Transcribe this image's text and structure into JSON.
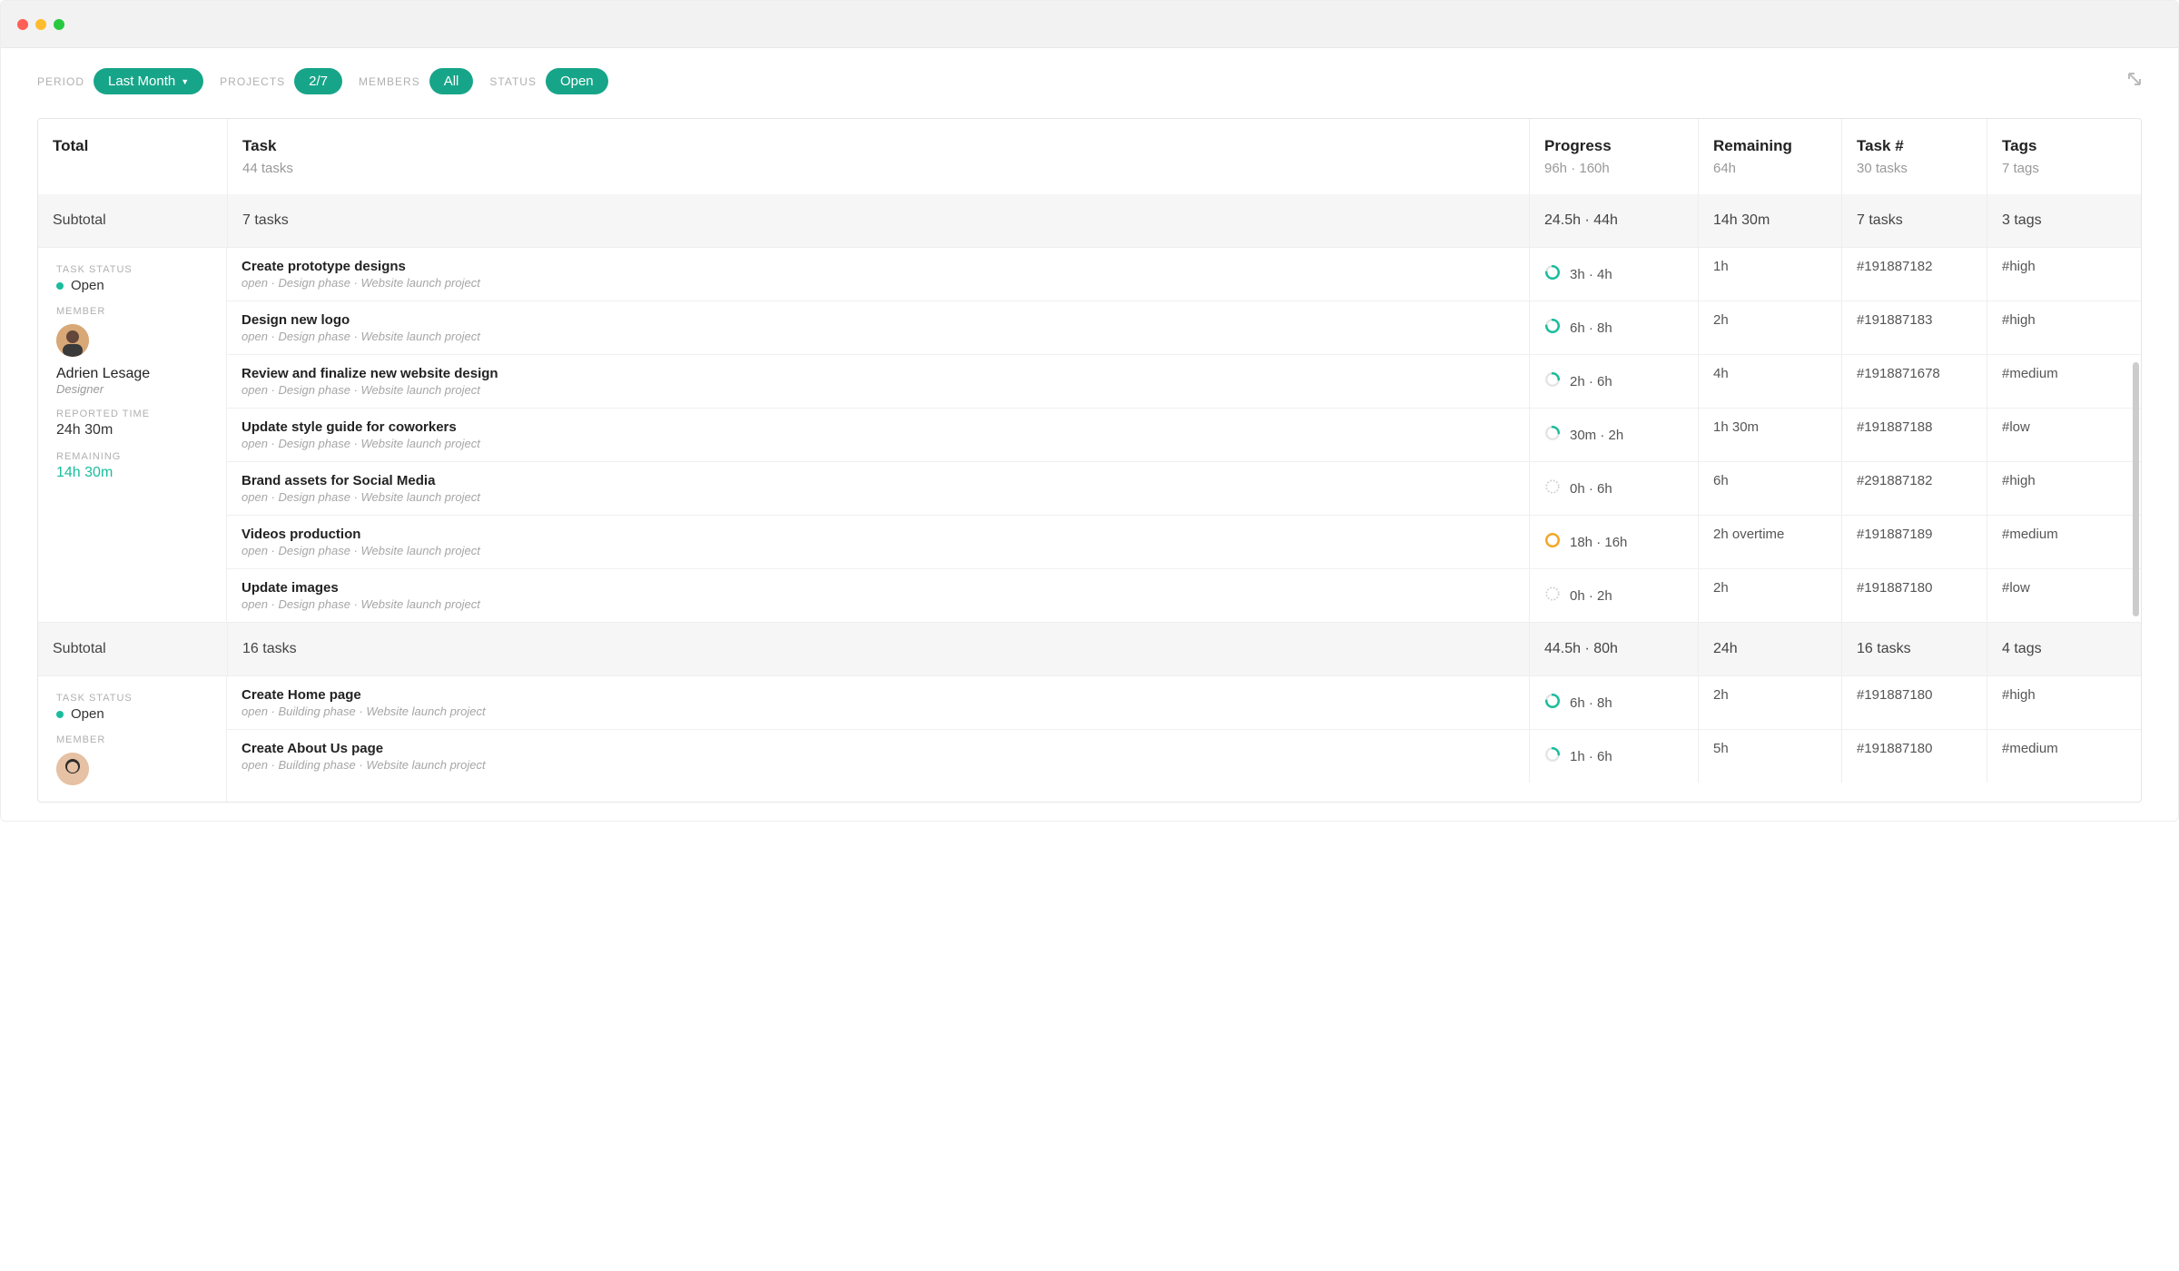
{
  "filters": {
    "period": {
      "label": "PERIOD",
      "value": "Last Month"
    },
    "projects": {
      "label": "PROJECTS",
      "value": "2/7"
    },
    "members": {
      "label": "MEMBERS",
      "value": "All"
    },
    "status": {
      "label": "STATUS",
      "value": "Open"
    }
  },
  "header": {
    "total_label": "Total",
    "task": {
      "label": "Task",
      "sub": "44 tasks"
    },
    "progress": {
      "label": "Progress",
      "sub": "96h · 160h"
    },
    "remaining": {
      "label": "Remaining",
      "sub": "64h"
    },
    "taskno": {
      "label": "Task #",
      "sub": "30 tasks"
    },
    "tags": {
      "label": "Tags",
      "sub": "7 tags"
    }
  },
  "groups": [
    {
      "subtotal": {
        "label": "Subtotal",
        "tasks": "7 tasks",
        "progress": "24.5h · 44h",
        "remaining": "14h 30m",
        "taskno": "7 tasks",
        "tags": "3 tags"
      },
      "side": {
        "status_label": "TASK STATUS",
        "status_value": "Open",
        "member_label": "MEMBER",
        "member_name": "Adrien Lesage",
        "member_role": "Designer",
        "reported_label": "REPORTED TIME",
        "reported_value": "24h 30m",
        "remaining_label": "REMAINING",
        "remaining_value": "14h 30m"
      },
      "tasks": [
        {
          "title": "Create prototype designs",
          "meta": "open · Design phase · Website launch project",
          "progress": "3h · 4h",
          "ring": "green-high",
          "remaining": "1h",
          "taskno": "#191887182",
          "tag": "#high"
        },
        {
          "title": "Design new logo",
          "meta": "open · Design phase · Website launch project",
          "progress": "6h · 8h",
          "ring": "green-high",
          "remaining": "2h",
          "taskno": "#191887183",
          "tag": "#high"
        },
        {
          "title": "Review and finalize new website design",
          "meta": "open · Design phase · Website launch project",
          "progress": "2h · 6h",
          "ring": "green-low",
          "remaining": "4h",
          "taskno": "#1918871678",
          "tag": "#medium"
        },
        {
          "title": "Update style guide for coworkers",
          "meta": "open · Design phase · Website launch project",
          "progress": "30m · 2h",
          "ring": "green-low",
          "remaining": "1h 30m",
          "taskno": "#191887188",
          "tag": "#low"
        },
        {
          "title": "Brand assets for Social Media",
          "meta": "open · Design phase · Website launch project",
          "progress": "0h · 6h",
          "ring": "empty",
          "remaining": "6h",
          "taskno": "#291887182",
          "tag": "#high"
        },
        {
          "title": "Videos production",
          "meta": "open · Design phase · Website launch project",
          "progress": "18h · 16h",
          "ring": "over",
          "remaining": "2h overtime",
          "overtime": true,
          "taskno": "#191887189",
          "tag": "#medium"
        },
        {
          "title": "Update images",
          "meta": "open · Design phase · Website launch project",
          "progress": "0h · 2h",
          "ring": "empty",
          "remaining": "2h",
          "taskno": "#191887180",
          "tag": "#low"
        }
      ]
    },
    {
      "subtotal": {
        "label": "Subtotal",
        "tasks": "16 tasks",
        "progress": "44.5h · 80h",
        "remaining": "24h",
        "taskno": "16 tasks",
        "tags": "4 tags"
      },
      "side": {
        "status_label": "TASK STATUS",
        "status_value": "Open",
        "member_label": "MEMBER"
      },
      "tasks": [
        {
          "title": "Create Home page",
          "meta": "open · Building phase · Website launch project",
          "progress": "6h · 8h",
          "ring": "green-high",
          "remaining": "2h",
          "taskno": "#191887180",
          "tag": "#high"
        },
        {
          "title": "Create About Us page",
          "meta": "open · Building phase · Website launch project",
          "progress": "1h · 6h",
          "ring": "green-low",
          "remaining": "5h",
          "taskno": "#191887180",
          "tag": "#medium"
        }
      ]
    }
  ]
}
